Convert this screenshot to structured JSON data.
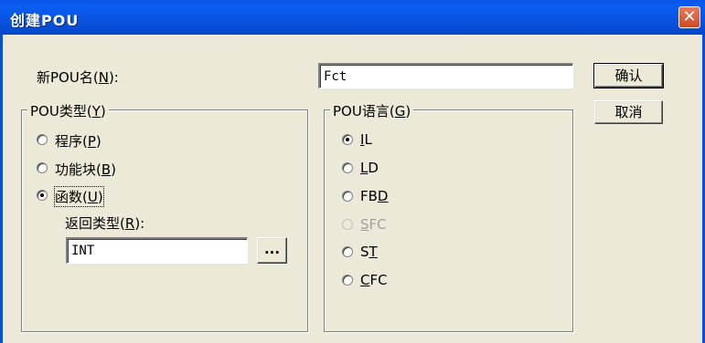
{
  "window": {
    "title": "创建POU",
    "close_glyph": "✕"
  },
  "name_field": {
    "label": "新POU名",
    "accel": "N",
    "accel_wrap_open": "(",
    "accel_wrap_close": "):",
    "value": "Fct"
  },
  "buttons": {
    "ok": "确认",
    "cancel": "取消",
    "browse": "..."
  },
  "pou_type": {
    "title": "POU类型",
    "accel": "Y",
    "options": [
      {
        "label": "程序",
        "accel": "P",
        "checked": false
      },
      {
        "label": "功能块",
        "accel": "B",
        "checked": false
      },
      {
        "label": "函数",
        "accel": "U",
        "checked": true
      }
    ],
    "return_type": {
      "label": "返回类型",
      "accel": "R",
      "value": "INT"
    }
  },
  "pou_language": {
    "title": "POU语言",
    "accel": "G",
    "options": [
      {
        "prefix": "",
        "accel": "I",
        "suffix": "L",
        "checked": true,
        "disabled": false
      },
      {
        "prefix": "",
        "accel": "L",
        "suffix": "D",
        "checked": false,
        "disabled": false
      },
      {
        "prefix": "FB",
        "accel": "D",
        "suffix": "",
        "checked": false,
        "disabled": false
      },
      {
        "prefix": "",
        "accel": "S",
        "suffix": "FC",
        "checked": false,
        "disabled": true
      },
      {
        "prefix": "S",
        "accel": "T",
        "suffix": "",
        "checked": false,
        "disabled": false
      },
      {
        "prefix": "",
        "accel": "C",
        "suffix": "FC",
        "checked": false,
        "disabled": false
      }
    ]
  }
}
